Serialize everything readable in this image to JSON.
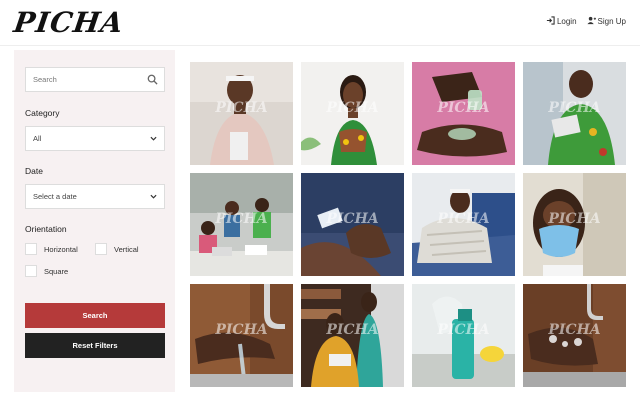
{
  "header": {
    "logo": "PICHA",
    "login_label": "Login",
    "signup_label": "Sign Up",
    "login_icon": "sign-in-icon",
    "signup_icon": "user-plus-icon"
  },
  "filters": {
    "search_placeholder": "Search",
    "category_label": "Category",
    "category_value": "All",
    "date_label": "Date",
    "date_value": "Select a date",
    "orientation_label": "Orientation",
    "orientation_options": [
      "Horizontal",
      "Vertical",
      "Square"
    ],
    "search_button": "Search",
    "reset_button": "Reset Filters"
  },
  "gallery": {
    "watermark": "PICHA",
    "photos": [
      "woman-white-headband-pink-sweater",
      "woman-green-print-dress",
      "hand-sanitizer-pink-background",
      "woman-tablet-green-dress",
      "office-team-laptops",
      "hands-wiping-phone",
      "woman-blanket-couch",
      "woman-blue-face-mask",
      "hands-washing-sink",
      "women-bookshelf-teal-dress",
      "gloved-hand-spray-bottle",
      "soapy-hands-washing"
    ]
  },
  "colors": {
    "sidebar_bg": "#f7f1f2",
    "search_button": "#b53a3a",
    "reset_button": "#222222"
  }
}
